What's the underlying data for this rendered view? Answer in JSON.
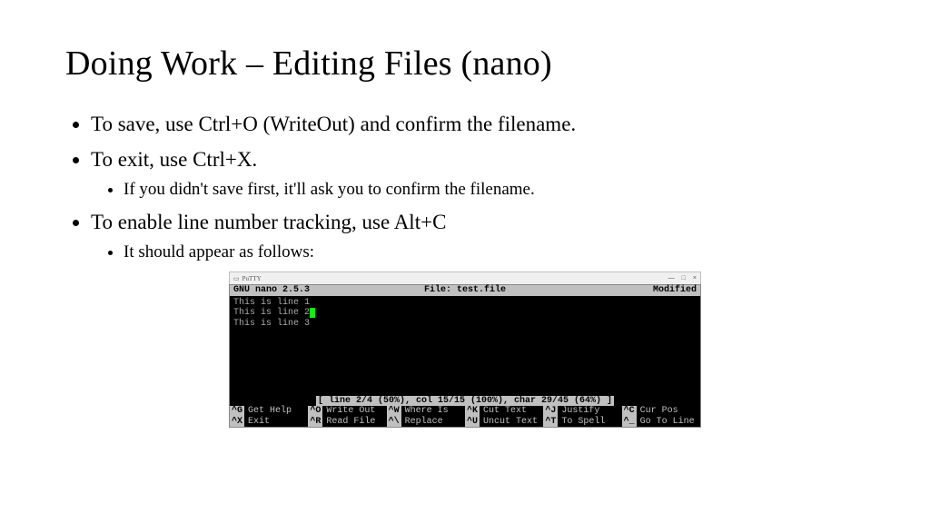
{
  "title": "Doing Work – Editing Files (nano)",
  "bullets": {
    "b1": "To save, use Ctrl+O (WriteOut) and confirm the filename.",
    "b2": "To exit, use Ctrl+X.",
    "b2s1": "If you didn't save first, it'll ask you to confirm the filename.",
    "b3": "To enable line number tracking, use Alt+C",
    "b3s1": "It should appear as follows:"
  },
  "window": {
    "title": "PuTTY",
    "min": "—",
    "max": "□",
    "close": "×"
  },
  "nano": {
    "version": "GNU nano 2.5.3",
    "file_label": "File: test.file",
    "modified": "Modified",
    "lines": {
      "l1": "This is line 1",
      "l2": "This is line 2",
      "l3": "This is line 3"
    },
    "status": "[ line 2/4 (50%), col 15/15 (100%), char 29/45 (64%) ]",
    "shortcuts": {
      "r1c1": {
        "k": "^G",
        "l": "Get Help"
      },
      "r1c2": {
        "k": "^O",
        "l": "Write Out"
      },
      "r1c3": {
        "k": "^W",
        "l": "Where Is"
      },
      "r1c4": {
        "k": "^K",
        "l": "Cut Text"
      },
      "r1c5": {
        "k": "^J",
        "l": "Justify"
      },
      "r1c6": {
        "k": "^C",
        "l": "Cur Pos"
      },
      "r2c1": {
        "k": "^X",
        "l": "Exit"
      },
      "r2c2": {
        "k": "^R",
        "l": "Read File"
      },
      "r2c3": {
        "k": "^\\",
        "l": "Replace"
      },
      "r2c4": {
        "k": "^U",
        "l": "Uncut Text"
      },
      "r2c5": {
        "k": "^T",
        "l": "To Spell"
      },
      "r2c6": {
        "k": "^_",
        "l": "Go To Line"
      }
    }
  }
}
